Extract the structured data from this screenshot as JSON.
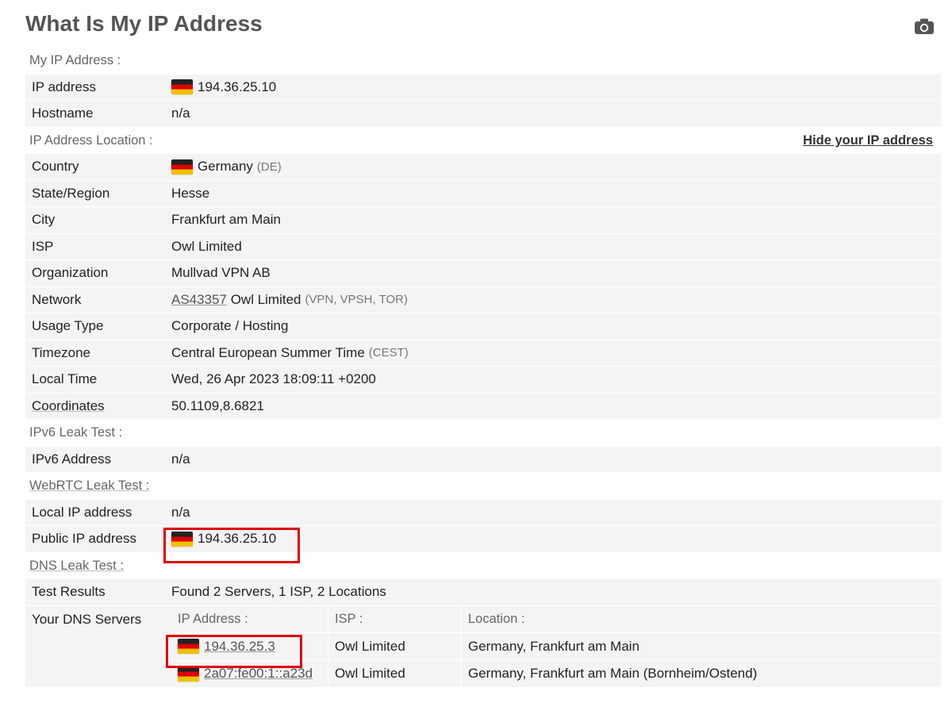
{
  "title": "What Is My IP Address",
  "camera_icon": "camera-icon",
  "sections": {
    "my_ip": "My IP Address :",
    "location": "IP Address Location :",
    "ipv6": "IPv6 Leak Test :",
    "webrtc": "WebRTC Leak Test :",
    "dns": "DNS Leak Test :"
  },
  "hide_link": "Hide your IP address",
  "my_ip": {
    "ip_label": "IP address",
    "ip_value": "194.36.25.10",
    "host_label": "Hostname",
    "host_value": "n/a"
  },
  "location": {
    "country_label": "Country",
    "country_value": "Germany",
    "country_code": "(DE)",
    "state_label": "State/Region",
    "state_value": "Hesse",
    "city_label": "City",
    "city_value": "Frankfurt am Main",
    "isp_label": "ISP",
    "isp_value": "Owl Limited",
    "org_label": "Organization",
    "org_value": "Mullvad VPN AB",
    "network_label": "Network",
    "network_as": "AS43357",
    "network_name": "Owl Limited",
    "network_tags": "(VPN, VPSH, TOR)",
    "usage_label": "Usage Type",
    "usage_value": "Corporate / Hosting",
    "tz_label": "Timezone",
    "tz_value": "Central European Summer Time",
    "tz_abbr": "(CEST)",
    "time_label": "Local Time",
    "time_value": "Wed, 26 Apr 2023 18:09:11 +0200",
    "coord_label": "Coordinates",
    "coord_value": "50.1109,8.6821"
  },
  "ipv6": {
    "label": "IPv6 Address",
    "value": "n/a"
  },
  "webrtc": {
    "local_label": "Local IP address",
    "local_value": "n/a",
    "public_label": "Public IP address",
    "public_value": "194.36.25.10"
  },
  "dns": {
    "results_label": "Test Results",
    "results_value": "Found 2 Servers, 1 ISP, 2 Locations",
    "servers_label": "Your DNS Servers",
    "headers": [
      "IP Address :",
      "ISP :",
      "Location :"
    ],
    "rows": [
      {
        "ip": "194.36.25.3",
        "isp": "Owl Limited",
        "location": "Germany, Frankfurt am Main"
      },
      {
        "ip": "2a07:fe00:1::a23d",
        "isp": "Owl Limited",
        "location": "Germany, Frankfurt am Main (Bornheim/Ostend)"
      }
    ]
  },
  "colors": {
    "highlight": "#e0000b",
    "row_bg": "#f4f4f4"
  }
}
